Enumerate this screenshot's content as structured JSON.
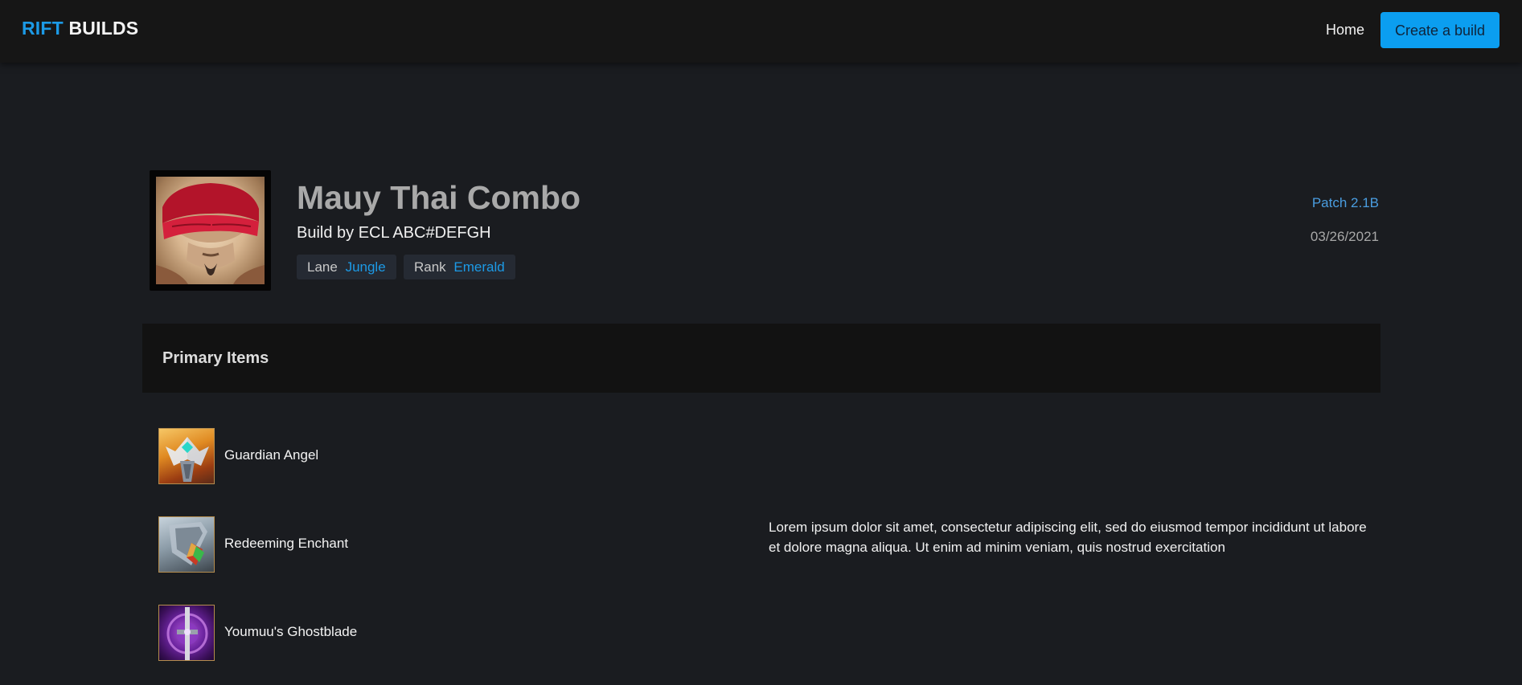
{
  "header": {
    "logo": {
      "part1": "RIFT",
      "part2": "BUILDS"
    },
    "nav_home": "Home",
    "create_button": "Create a build"
  },
  "build": {
    "title": "Mauy Thai Combo",
    "author_line": "Build by ECL ABC#DEFGH",
    "tags": [
      {
        "label": "Lane",
        "value": "Jungle"
      },
      {
        "label": "Rank",
        "value": "Emerald"
      }
    ],
    "patch": "Patch 2.1B",
    "date": "03/26/2021",
    "champion_portrait": "champion-portrait"
  },
  "primary_items": {
    "title": "Primary Items",
    "items": [
      {
        "name": "Guardian Angel",
        "icon": "guardian-angel-icon"
      },
      {
        "name": "Redeeming Enchant",
        "icon": "redeeming-enchant-icon"
      },
      {
        "name": "Youmuu's Ghostblade",
        "icon": "youmuus-ghostblade-icon"
      }
    ],
    "description": "Lorem ipsum dolor sit amet, consectetur adipiscing elit, sed do eiusmod tempor incididunt ut labore et dolore magna aliqua. Ut enim ad minim veniam, quis nostrud exercitation"
  },
  "colors": {
    "accent": "#0b9ef0",
    "link": "#1c9ae6",
    "background": "#1a1c20",
    "header_bg": "#161616",
    "section_bg": "#121212"
  }
}
